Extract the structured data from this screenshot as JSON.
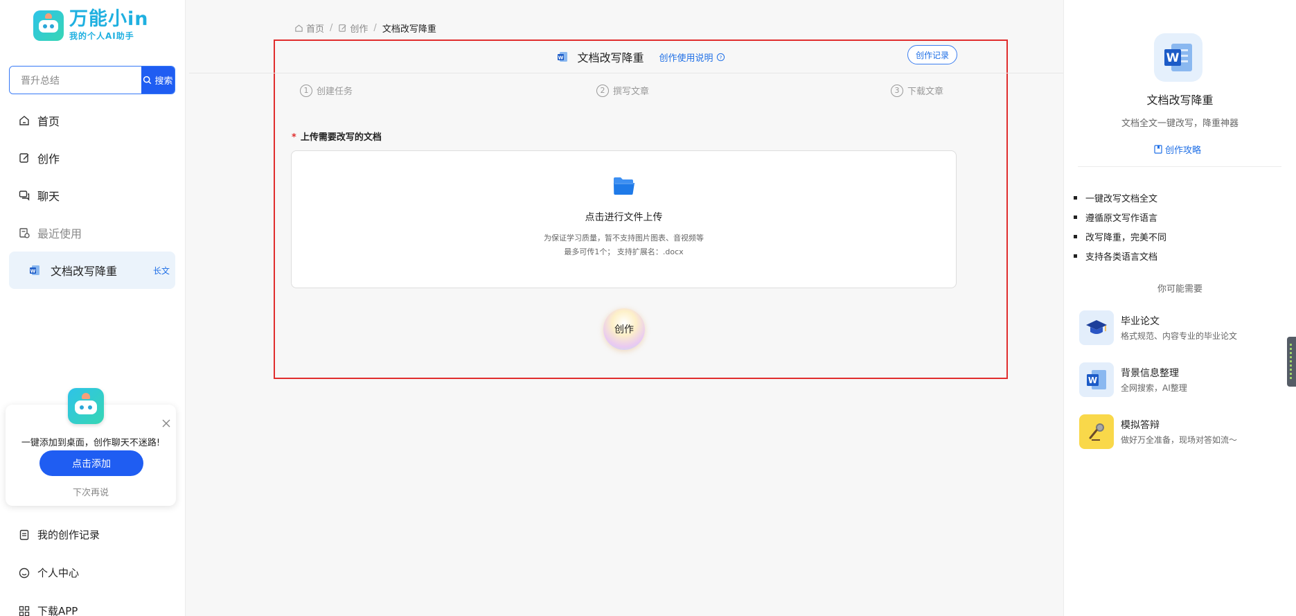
{
  "app": {
    "logo_title": "万能小in",
    "logo_subtitle": "我的个人AI助手"
  },
  "search": {
    "value": "晋升总结",
    "button_label": "搜索"
  },
  "nav": {
    "home": "首页",
    "create": "创作",
    "chat": "聊天",
    "recent": "最近使用",
    "recent_item": {
      "label": "文档改写降重",
      "tag": "长文"
    },
    "my_records": "我的创作记录",
    "personal_center": "个人中心",
    "download_app": "下载APP"
  },
  "promo": {
    "text": "一键添加到桌面，创作聊天不迷路!",
    "button": "点击添加",
    "later": "下次再说"
  },
  "breadcrumb": {
    "home": "首页",
    "create": "创作",
    "current": "文档改写降重"
  },
  "card": {
    "title": "文档改写降重",
    "usage_link": "创作使用说明",
    "record_button": "创作记录",
    "steps": [
      {
        "num": "1",
        "label": "创建任务"
      },
      {
        "num": "2",
        "label": "撰写文章"
      },
      {
        "num": "3",
        "label": "下载文章"
      }
    ],
    "upload_label": "上传需要改写的文档",
    "required_mark": "*",
    "upload_main": "点击进行文件上传",
    "upload_hint1": "为保证学习质量，暂不支持图片图表、音视频等",
    "upload_hint2": "最多可传1个； 支持扩展名：.docx",
    "create_button": "创作"
  },
  "right_panel": {
    "title": "文档改写降重",
    "desc": "文档全文一键改写，降重神器",
    "guide": "创作攻略",
    "features": [
      "一键改写文档全文",
      "遵循原文写作语言",
      "改写降重，完美不同",
      "支持各类语言文档"
    ],
    "maybe_title": "你可能需要",
    "recommendations": [
      {
        "title": "毕业论文",
        "sub": "格式规范、内容专业的毕业论文"
      },
      {
        "title": "背景信息整理",
        "sub": "全网搜索，AI整理"
      },
      {
        "title": "模拟答辩",
        "sub": "做好万全准备，现场对答如流～"
      }
    ]
  },
  "colors": {
    "primary": "#1f5df2",
    "link": "#1f6fe6",
    "highlight_border": "#e02d2d",
    "brand": "#1fb0e0"
  }
}
